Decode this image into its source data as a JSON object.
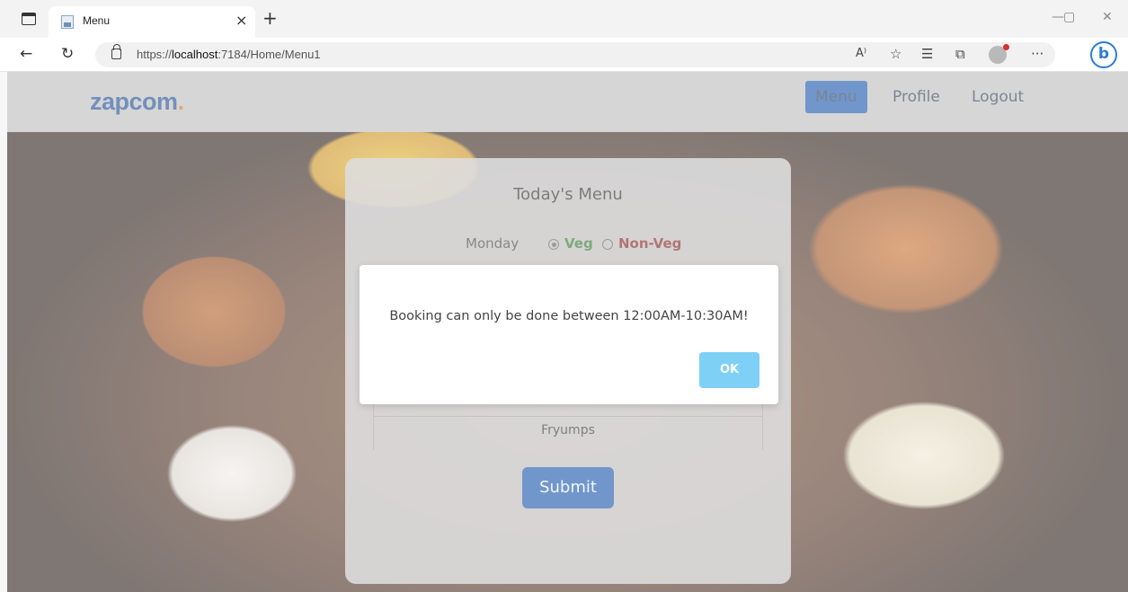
{
  "browser": {
    "tab_title": "Menu",
    "tab_close": "×",
    "new_tab": "+",
    "url_prefix": "https://",
    "url_host": "localhost",
    "url_rest": ":7184/Home/Menu1",
    "window_minimize": "—",
    "window_maximize": "▢",
    "window_close": "✕",
    "icons": [
      "tab-actions-icon",
      "back-icon",
      "refresh-icon",
      "lock-icon",
      "read-aloud-icon",
      "favorite-icon",
      "favorites-icon",
      "collections-icon",
      "profile-icon",
      "more-icon",
      "bing-icon"
    ]
  },
  "header": {
    "logo_text": "zapcom",
    "logo_dot": ".",
    "nav": [
      "Menu",
      "Profile",
      "Logout"
    ],
    "active_nav": "Menu"
  },
  "card": {
    "title": "Today's Menu",
    "day": "Monday",
    "veg_label": "Veg",
    "nonveg_label": "Non-Veg",
    "selected_option": "Veg",
    "menu_items": [
      "Fryumps"
    ],
    "submit_label": "Submit"
  },
  "dialog": {
    "message": "Booking can only be done between 12:00AM-10:30AM!",
    "ok_label": "OK"
  },
  "colors": {
    "brand_blue": "#0b4aa6",
    "logo_orange": "#d56a16",
    "veg_green": "#1e6d1e",
    "nonveg_red": "#7a1010",
    "ok_button": "#7fd0f6"
  }
}
